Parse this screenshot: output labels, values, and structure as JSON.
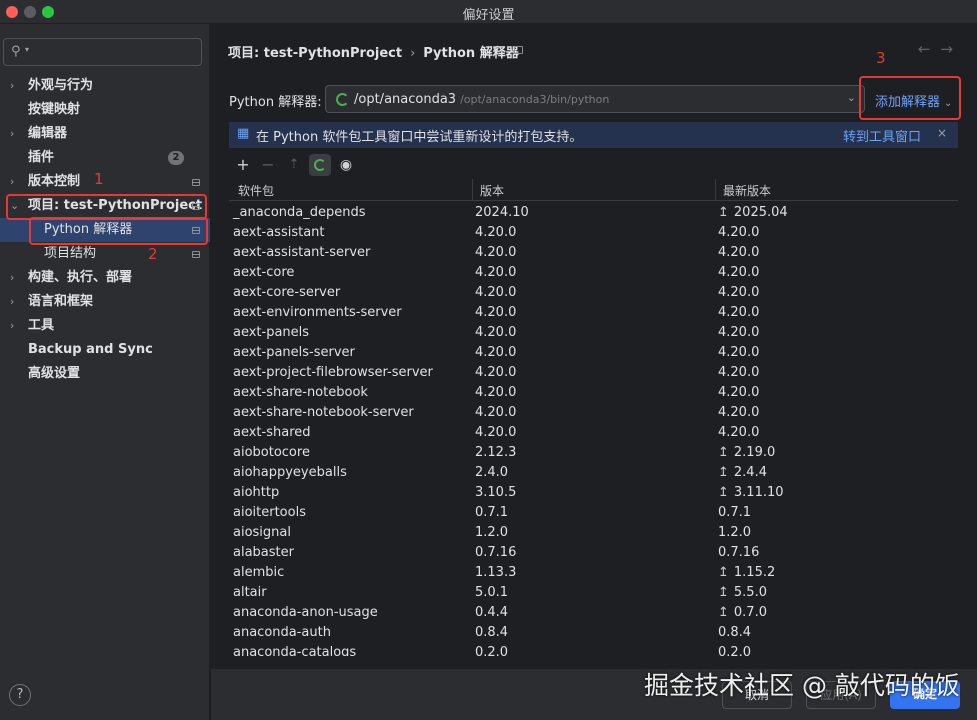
{
  "window": {
    "title": "偏好设置"
  },
  "sidebar": {
    "search_placeholder": "",
    "items": [
      {
        "label": "外观与行为",
        "expandable": true
      },
      {
        "label": "按键映射",
        "expandable": false
      },
      {
        "label": "编辑器",
        "expandable": true
      },
      {
        "label": "插件",
        "expandable": false,
        "badge": "2"
      },
      {
        "label": "版本控制",
        "expandable": true
      },
      {
        "label": "项目: test-PythonProject",
        "expandable": true,
        "expanded": true
      },
      {
        "label": "Python 解释器",
        "child": true,
        "selected": true
      },
      {
        "label": "项目结构",
        "child": true
      },
      {
        "label": "构建、执行、部署",
        "expandable": true
      },
      {
        "label": "语言和框架",
        "expandable": true
      },
      {
        "label": "工具",
        "expandable": true
      },
      {
        "label": "Backup and Sync",
        "expandable": false
      },
      {
        "label": "高级设置",
        "expandable": false
      }
    ],
    "help": "?"
  },
  "annotations": {
    "n1": "1",
    "n2": "2",
    "n3": "3",
    "color": "#e53935"
  },
  "main": {
    "breadcrumb": {
      "project": "项目: test-PythonProject",
      "separator": "›",
      "page": "Python 解释器"
    },
    "interpreter": {
      "label": "Python 解释器:",
      "name": "/opt/anaconda3",
      "path": "/opt/anaconda3/bin/python",
      "add_label": "添加解释器"
    },
    "banner": {
      "text": "在 Python 软件包工具窗口中尝试重新设计的打包支持。",
      "link": "转到工具窗口",
      "close": "×"
    },
    "table": {
      "headers": [
        "软件包",
        "版本",
        "最新版本"
      ],
      "rows": [
        {
          "pkg": "_anaconda_depends",
          "ver": "2024.10",
          "latest": "2025.04",
          "upgrade": true
        },
        {
          "pkg": "aext-assistant",
          "ver": "4.20.0",
          "latest": "4.20.0",
          "upgrade": false
        },
        {
          "pkg": "aext-assistant-server",
          "ver": "4.20.0",
          "latest": "4.20.0",
          "upgrade": false
        },
        {
          "pkg": "aext-core",
          "ver": "4.20.0",
          "latest": "4.20.0",
          "upgrade": false
        },
        {
          "pkg": "aext-core-server",
          "ver": "4.20.0",
          "latest": "4.20.0",
          "upgrade": false
        },
        {
          "pkg": "aext-environments-server",
          "ver": "4.20.0",
          "latest": "4.20.0",
          "upgrade": false
        },
        {
          "pkg": "aext-panels",
          "ver": "4.20.0",
          "latest": "4.20.0",
          "upgrade": false
        },
        {
          "pkg": "aext-panels-server",
          "ver": "4.20.0",
          "latest": "4.20.0",
          "upgrade": false
        },
        {
          "pkg": "aext-project-filebrowser-server",
          "ver": "4.20.0",
          "latest": "4.20.0",
          "upgrade": false
        },
        {
          "pkg": "aext-share-notebook",
          "ver": "4.20.0",
          "latest": "4.20.0",
          "upgrade": false
        },
        {
          "pkg": "aext-share-notebook-server",
          "ver": "4.20.0",
          "latest": "4.20.0",
          "upgrade": false
        },
        {
          "pkg": "aext-shared",
          "ver": "4.20.0",
          "latest": "4.20.0",
          "upgrade": false
        },
        {
          "pkg": "aiobotocore",
          "ver": "2.12.3",
          "latest": "2.19.0",
          "upgrade": true
        },
        {
          "pkg": "aiohappyeyeballs",
          "ver": "2.4.0",
          "latest": "2.4.4",
          "upgrade": true
        },
        {
          "pkg": "aiohttp",
          "ver": "3.10.5",
          "latest": "3.11.10",
          "upgrade": true
        },
        {
          "pkg": "aioitertools",
          "ver": "0.7.1",
          "latest": "0.7.1",
          "upgrade": false
        },
        {
          "pkg": "aiosignal",
          "ver": "1.2.0",
          "latest": "1.2.0",
          "upgrade": false
        },
        {
          "pkg": "alabaster",
          "ver": "0.7.16",
          "latest": "0.7.16",
          "upgrade": false
        },
        {
          "pkg": "alembic",
          "ver": "1.13.3",
          "latest": "1.15.2",
          "upgrade": true
        },
        {
          "pkg": "altair",
          "ver": "5.0.1",
          "latest": "5.5.0",
          "upgrade": true
        },
        {
          "pkg": "anaconda-anon-usage",
          "ver": "0.4.4",
          "latest": "0.7.0",
          "upgrade": true
        },
        {
          "pkg": "anaconda-auth",
          "ver": "0.8.4",
          "latest": "0.8.4",
          "upgrade": false
        },
        {
          "pkg": "anaconda-catalogs",
          "ver": "0.2.0",
          "latest": "0.2.0",
          "upgrade": false
        }
      ]
    }
  },
  "footer": {
    "cancel": "取消",
    "apply": "应用(A)",
    "ok": "确定"
  },
  "watermark": "掘金技术社区 @ 敲代码的饭"
}
